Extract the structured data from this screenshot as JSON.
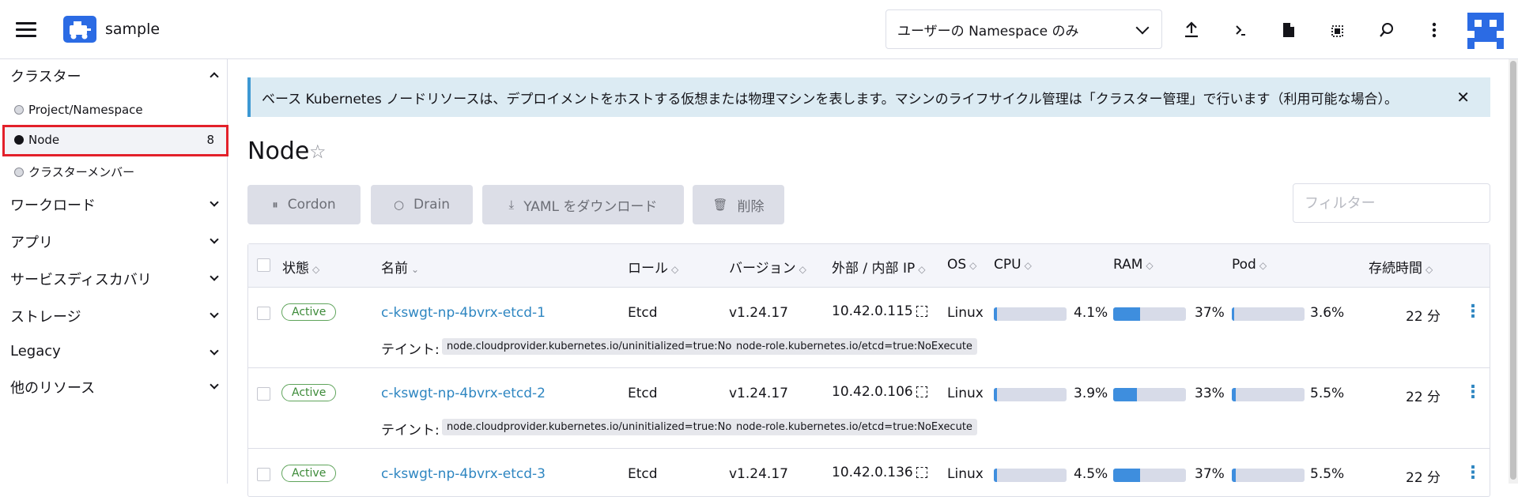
{
  "header": {
    "cluster_name": "sample",
    "namespace_select": "ユーザーの Namespace のみ",
    "icons": [
      "upload-icon",
      "terminal-icon",
      "file-icon",
      "copy-config-icon",
      "search-icon",
      "more-vertical-icon"
    ]
  },
  "sidebar": {
    "cluster_group": "クラスター",
    "items": [
      {
        "label": "Project/Namespace"
      },
      {
        "label": "Node",
        "count": "8"
      },
      {
        "label": "クラスターメンバー"
      }
    ],
    "groups": [
      "ワークロード",
      "アプリ",
      "サービスディスカバリ",
      "ストレージ",
      "Legacy",
      "他のリソース"
    ]
  },
  "banner": {
    "text": "ベース Kubernetes ノードリソースは、デプロイメントをホストする仮想または物理マシンを表します。マシンのライフサイクル管理は「クラスター管理」で行います（利用可能な場合）。"
  },
  "page": {
    "title": "Node"
  },
  "toolbar": {
    "cordon": "Cordon",
    "drain": "Drain",
    "yaml": "YAML をダウンロード",
    "delete": "削除",
    "filter_placeholder": "フィルター"
  },
  "table": {
    "headers": {
      "state": "状態",
      "name": "名前",
      "role": "ロール",
      "version": "バージョン",
      "ip": "外部 / 内部 IP",
      "os": "OS",
      "cpu": "CPU",
      "ram": "RAM",
      "pod": "Pod",
      "age": "存続時間"
    },
    "taint_label": "テイント:",
    "rows": [
      {
        "state": "Active",
        "name": "c-kswgt-np-4bvrx-etcd-1",
        "role": "Etcd",
        "version": "v1.24.17",
        "ip": "10.42.0.115",
        "os": "Linux",
        "cpu": "4.1%",
        "cpu_val": 4.1,
        "ram": "37%",
        "ram_val": 37,
        "pod": "3.6%",
        "pod_val": 3.6,
        "age": "22 分",
        "taints": [
          "node.cloudprovider.kubernetes.io/uninitialized=true:NoSchedule",
          "node-role.kubernetes.io/etcd=true:NoExecute"
        ]
      },
      {
        "state": "Active",
        "name": "c-kswgt-np-4bvrx-etcd-2",
        "role": "Etcd",
        "version": "v1.24.17",
        "ip": "10.42.0.106",
        "os": "Linux",
        "cpu": "3.9%",
        "cpu_val": 3.9,
        "ram": "33%",
        "ram_val": 33,
        "pod": "5.5%",
        "pod_val": 5.5,
        "age": "22 分",
        "taints": [
          "node.cloudprovider.kubernetes.io/uninitialized=true:NoSchedule",
          "node-role.kubernetes.io/etcd=true:NoExecute"
        ]
      },
      {
        "state": "Active",
        "name": "c-kswgt-np-4bvrx-etcd-3",
        "role": "Etcd",
        "version": "v1.24.17",
        "ip": "10.42.0.136",
        "os": "Linux",
        "cpu": "4.5%",
        "cpu_val": 4.5,
        "ram": "37%",
        "ram_val": 37,
        "pod": "5.5%",
        "pod_val": 5.5,
        "age": "22 分",
        "taints": []
      }
    ]
  }
}
